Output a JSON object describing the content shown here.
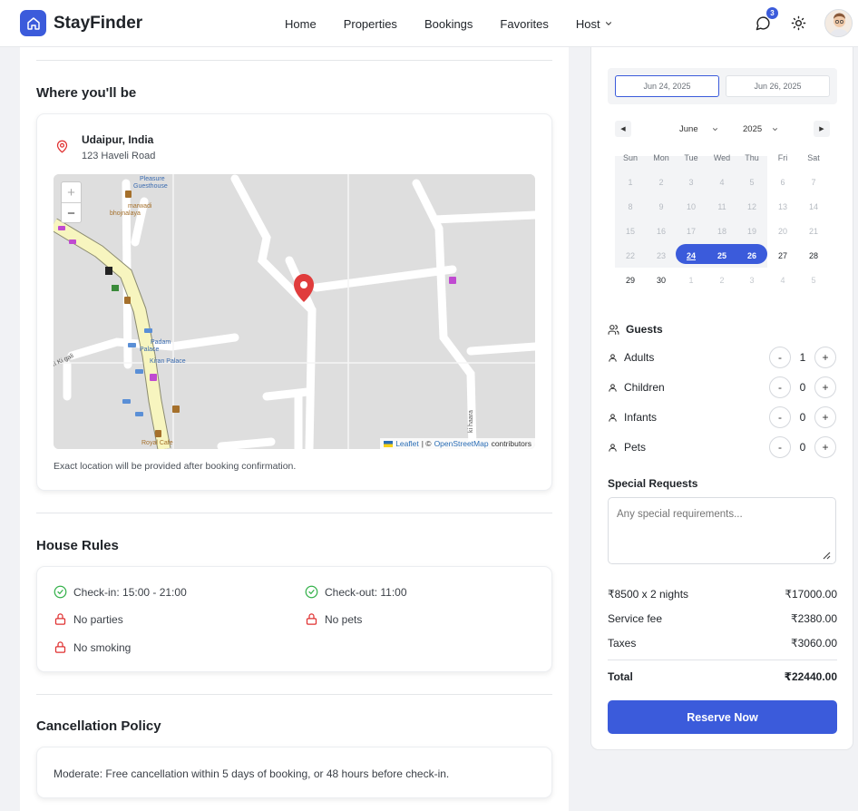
{
  "brand": {
    "name": "StayFinder",
    "accent": "#3b5bdb"
  },
  "nav": {
    "items": [
      {
        "label": "Home"
      },
      {
        "label": "Properties"
      },
      {
        "label": "Bookings"
      },
      {
        "label": "Favorites"
      },
      {
        "label": "Host",
        "has_dropdown": true
      }
    ]
  },
  "header": {
    "messages_badge": "3",
    "icons": [
      "message-icon",
      "sun-icon",
      "avatar"
    ]
  },
  "location": {
    "section_title": "Where you'll be",
    "city": "Udaipur, India",
    "address": "123 Haveli Road",
    "note": "Exact location will be provided after booking confirmation.",
    "map": {
      "zoom_in": "+",
      "zoom_out": "−",
      "labels": {
        "pleasure_guesthouse": "Pleasure Guesthouse",
        "marwadi": "marwadi bhojnalaya",
        "padam": "Padam Palace",
        "kiran": "Kiran Palace",
        "royal": "Royal Cafe",
        "gali": "Ki gali",
        "haara": "ki haara"
      },
      "attribution": {
        "leaflet": "Leaflet",
        "sep": "| ©",
        "osm": "OpenStreetMap",
        "suffix": "contributors"
      }
    }
  },
  "house_rules": {
    "title": "House Rules",
    "items": [
      {
        "label": "Check-in: 15:00 - 21:00",
        "icon": "check-circle-icon",
        "allowed": true
      },
      {
        "label": "Check-out: 11:00",
        "icon": "check-circle-icon",
        "allowed": true
      },
      {
        "label": "No parties",
        "icon": "lock-icon",
        "allowed": false
      },
      {
        "label": "No pets",
        "icon": "lock-icon",
        "allowed": false
      },
      {
        "label": "No smoking",
        "icon": "lock-icon",
        "allowed": false
      }
    ]
  },
  "cancellation": {
    "title": "Cancellation Policy",
    "text": "Moderate: Free cancellation within 5 days of booking, or 48 hours before check-in."
  },
  "booking": {
    "check_in": "Jun 24, 2025",
    "check_out": "Jun 26, 2025",
    "calendar": {
      "month": "June",
      "year": "2025",
      "weekdays": [
        "Sun",
        "Mon",
        "Tue",
        "Wed",
        "Thu",
        "Fri",
        "Sat"
      ],
      "weeks": [
        [
          "1",
          "2",
          "3",
          "4",
          "5",
          "6",
          "7"
        ],
        [
          "8",
          "9",
          "10",
          "11",
          "12",
          "13",
          "14"
        ],
        [
          "15",
          "16",
          "17",
          "18",
          "19",
          "20",
          "21"
        ],
        [
          "22",
          "23",
          "24",
          "25",
          "26",
          "27",
          "28"
        ],
        [
          "29",
          "30",
          "1",
          "2",
          "3",
          "4",
          "5"
        ]
      ]
    },
    "guests": {
      "title": "Guests",
      "rows": [
        {
          "label": "Adults",
          "value": "1"
        },
        {
          "label": "Children",
          "value": "0"
        },
        {
          "label": "Infants",
          "value": "0"
        },
        {
          "label": "Pets",
          "value": "0"
        }
      ],
      "minus": "-",
      "plus": "+"
    },
    "special_requests": {
      "title": "Special Requests",
      "placeholder": "Any special requirements..."
    },
    "pricing": [
      {
        "label": "₹8500 x 2 nights",
        "amount": "₹17000.00"
      },
      {
        "label": "Service fee",
        "amount": "₹2380.00"
      },
      {
        "label": "Taxes",
        "amount": "₹3060.00"
      }
    ],
    "total": {
      "label": "Total",
      "amount": "₹22440.00"
    },
    "reserve_label": "Reserve Now"
  }
}
